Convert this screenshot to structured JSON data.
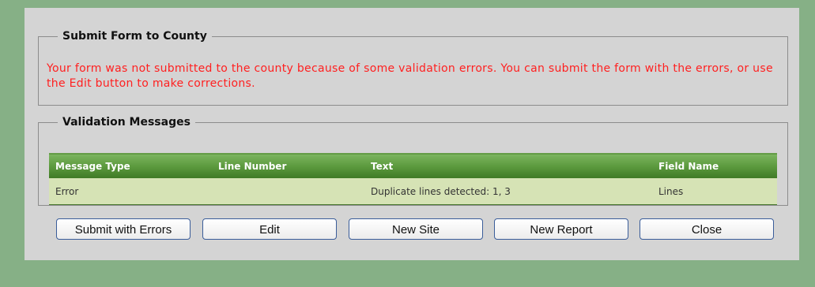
{
  "submit_section": {
    "title": "Submit Form to County",
    "message": "Your form was not submitted to the county because of some validation errors. You can submit the form with the errors, or use the Edit button to make corrections."
  },
  "validation_section": {
    "title": "Validation Messages",
    "columns": [
      "Message Type",
      "Line Number",
      "Text",
      "Field Name"
    ],
    "rows": [
      {
        "message_type": "Error",
        "line_number": "",
        "text": "Duplicate lines detected: 1, 3",
        "field_name": "Lines"
      }
    ]
  },
  "buttons": {
    "submit_with_errors": "Submit with Errors",
    "edit": "Edit",
    "new_site": "New Site",
    "new_report": "New Report",
    "close": "Close"
  },
  "colors": {
    "error_text": "#ff2020",
    "header_green": "#5c9a3e",
    "row_bg": "#d6e3b5",
    "page_bg": "#86b086"
  }
}
